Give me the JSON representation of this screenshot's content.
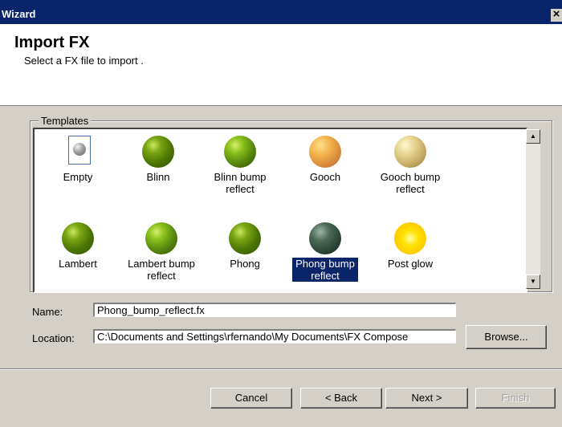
{
  "window": {
    "title": "Wizard",
    "close_glyph": "×"
  },
  "header": {
    "title": "Import FX",
    "subtitle": "Select a FX file to import ."
  },
  "templates": {
    "group_label": "Templates",
    "items": [
      {
        "label": "Empty",
        "icon": "empty-file-icon"
      },
      {
        "label": "Blinn",
        "icon": "blinn-sphere-icon"
      },
      {
        "label": "Blinn bump\nreflect",
        "icon": "blinn-bump-reflect-sphere-icon"
      },
      {
        "label": "Gooch",
        "icon": "gooch-sphere-icon"
      },
      {
        "label": "Gooch bump\nreflect",
        "icon": "gooch-bump-reflect-sphere-icon"
      },
      {
        "label": "Lambert",
        "icon": "lambert-sphere-icon"
      },
      {
        "label": "Lambert bump\nreflect",
        "icon": "lambert-bump-reflect-sphere-icon"
      },
      {
        "label": "Phong",
        "icon": "phong-sphere-icon"
      },
      {
        "label": "Phong bump\nreflect",
        "icon": "phong-bump-reflect-sphere-icon",
        "selected": true
      },
      {
        "label": "Post glow",
        "icon": "post-glow-sphere-icon"
      }
    ],
    "scroll_up_glyph": "▲",
    "scroll_down_glyph": "▼"
  },
  "form": {
    "name_label": "Name:",
    "name_value": "Phong_bump_reflect.fx",
    "location_label": "Location:",
    "location_value": "C:\\Documents and Settings\\rfernando\\My Documents\\FX Compose",
    "browse_label": "Browse..."
  },
  "buttons": {
    "cancel": "Cancel",
    "back": "< Back",
    "next": "Next >",
    "finish": "Finish"
  }
}
